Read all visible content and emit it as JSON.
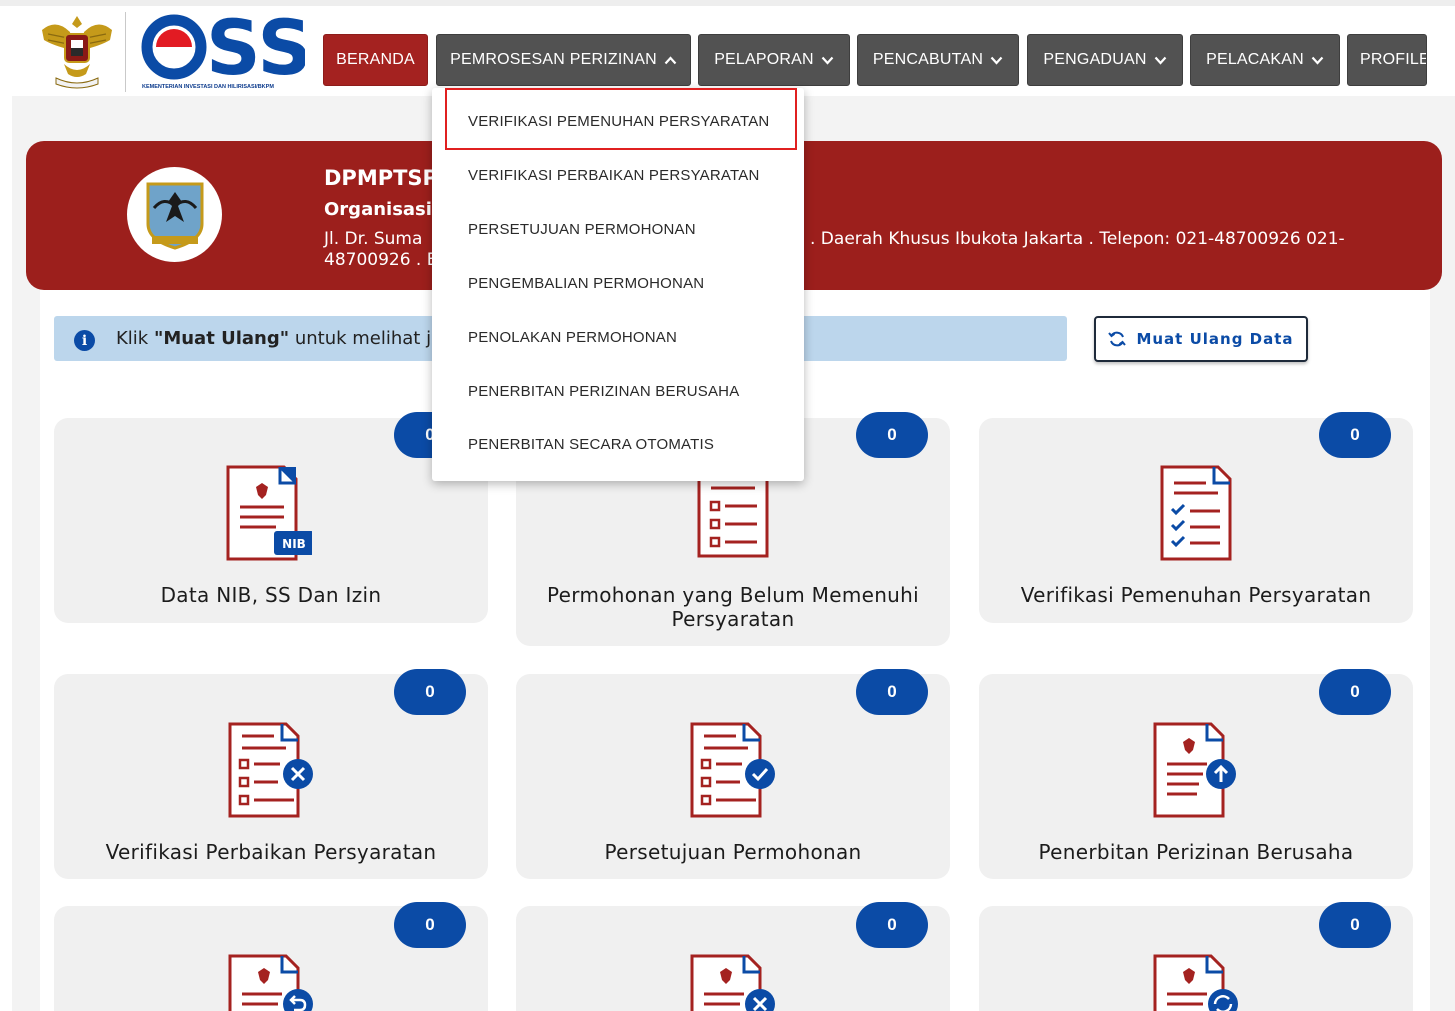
{
  "header": {
    "logo_text": "OSS",
    "logo_subtitle": "KEMENTERIAN INVESTASI DAN HILIRISASI/BKPM",
    "nav": [
      {
        "label": "BERANDA",
        "active": true,
        "chevron": "none"
      },
      {
        "label": "PEMROSESAN PERIZINAN",
        "active": false,
        "chevron": "up"
      },
      {
        "label": "PELAPORAN",
        "active": false,
        "chevron": "down"
      },
      {
        "label": "PENCABUTAN",
        "active": false,
        "chevron": "down"
      },
      {
        "label": "PENGADUAN",
        "active": false,
        "chevron": "down"
      },
      {
        "label": "PELACAKAN",
        "active": false,
        "chevron": "down"
      },
      {
        "label": "PROFILE",
        "active": false,
        "chevron": "none"
      }
    ]
  },
  "dropdown": {
    "items": [
      "VERIFIKASI PEMENUHAN PERSYARATAN",
      "VERIFIKASI PERBAIKAN PERSYARATAN",
      "PERSETUJUAN PERMOHONAN",
      "PENGEMBALIAN PERMOHONAN",
      "PENOLAKAN PERMOHONAN",
      "PENERBITAN PERIZINAN BERUSAHA",
      "PENERBITAN SECARA OTOMATIS"
    ],
    "highlighted_index": 0
  },
  "banner": {
    "title": "DPMPTSP",
    "org": "Organisasi",
    "address_line1_a": "Jl. Dr. Suma",
    "address_line1_b": ". Daerah Khusus Ibukota Jakarta . Telepon: 021-48700926 021-",
    "address_line2": "48700926 . E"
  },
  "info": {
    "prefix": "Klik ",
    "bold": "\"Muat Ulang\"",
    "suffix": " untuk melihat ju"
  },
  "reload_button": {
    "label": "Muat Ulang Data",
    "icon": "refresh-icon"
  },
  "cards": [
    {
      "label": "Data NIB, SS Dan Izin",
      "count": "0",
      "icon": "nib-document-icon"
    },
    {
      "label": "Permohonan yang Belum Memenuhi Persyaratan",
      "count": "0",
      "icon": "list-document-icon"
    },
    {
      "label": "Verifikasi Pemenuhan Persyaratan",
      "count": "0",
      "icon": "checklist-document-icon"
    },
    {
      "label": "Verifikasi Perbaikan Persyaratan",
      "count": "0",
      "icon": "rejected-list-document-icon"
    },
    {
      "label": "Persetujuan Permohonan",
      "count": "0",
      "icon": "approved-list-document-icon"
    },
    {
      "label": "Penerbitan Perizinan Berusaha",
      "count": "0",
      "icon": "upload-document-icon"
    },
    {
      "label": "",
      "count": "0",
      "icon": "return-document-icon"
    },
    {
      "label": "",
      "count": "0",
      "icon": "cancel-document-icon"
    },
    {
      "label": "",
      "count": "0",
      "icon": "sync-document-icon"
    }
  ],
  "colors": {
    "brand_red": "#a42220",
    "nav_gray": "#525252",
    "badge_blue": "#0b4ba6",
    "icon_red": "#a42220",
    "icon_blue": "#0b4ba6",
    "info_bg": "#bcd6ec"
  }
}
